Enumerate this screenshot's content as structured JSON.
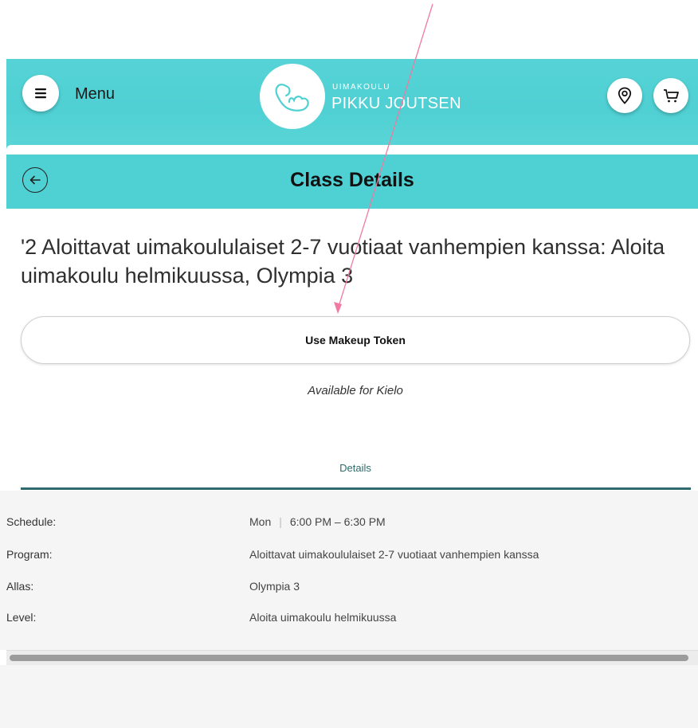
{
  "header": {
    "menu_label": "Menu",
    "logo_small": "UIMAKOULU",
    "logo_big": "PIKKU JOUTSEN",
    "icons": [
      "menu-icon",
      "swan-logo",
      "location-pin-icon",
      "cart-icon"
    ],
    "color": "#4fd0d3"
  },
  "titlebar": {
    "title": "Class Details",
    "back_icon": "back-arrow-icon"
  },
  "class": {
    "title": "'2 Aloittavat uimakoululaiset 2-7 vuotiaat vanhempien kanssa: Aloita uimakoulu helmikuussa, Olympia 3",
    "makeup_button": "Use Makeup Token",
    "available_text": "Available for Kielo"
  },
  "details": {
    "tab_label": "Details",
    "accent_color": "#2f6b6c",
    "rows": [
      {
        "label": "Schedule:",
        "day": "Mon",
        "separator": "|",
        "time": "6:00 PM – 6:30 PM"
      },
      {
        "label": "Program:",
        "value": "Aloittavat uimakoululaiset 2-7 vuotiaat vanhempien kanssa"
      },
      {
        "label": "Allas:",
        "value": "Olympia 3"
      },
      {
        "label": "Level:",
        "value": "Aloita uimakoulu helmikuussa"
      }
    ]
  },
  "annotation": {
    "arrow_color": "#f07aa0"
  }
}
